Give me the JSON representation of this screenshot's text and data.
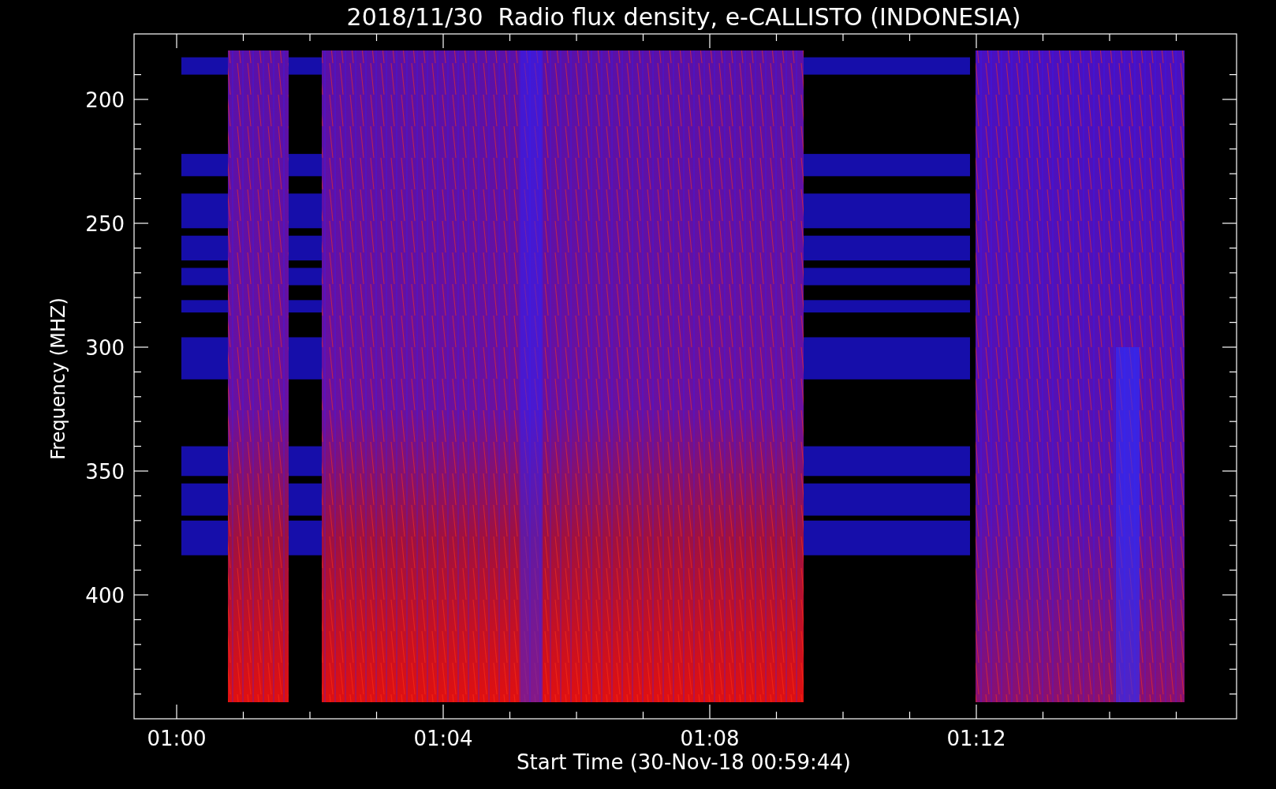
{
  "title": "2018/11/30  Radio flux density, e-CALLISTO (INDONESIA)",
  "plot": {
    "ylabel": "Frequency (MHZ)",
    "xlabel": "Start Time (30-Nov-18 00:59:44)",
    "yticks": [
      "200",
      "250",
      "300",
      "350",
      "400"
    ],
    "xticks": [
      "01:00",
      "01:04",
      "01:08",
      "01:12"
    ]
  }
}
